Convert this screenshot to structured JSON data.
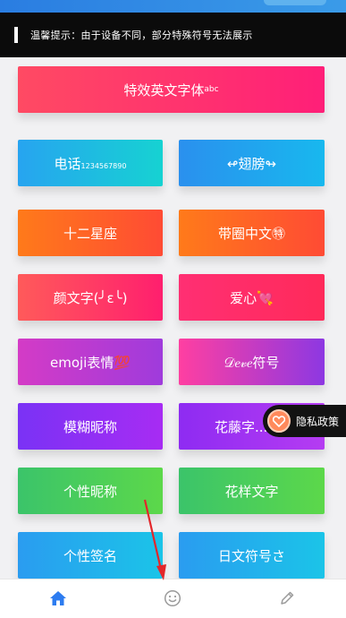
{
  "notice": {
    "text": "温馨提示：由于设备不同，部分特殊符号无法展示"
  },
  "buttons": {
    "special_en": {
      "label": "特效英文字体",
      "sup": "abc"
    },
    "phone": {
      "label": "电话",
      "sub": "1234567890"
    },
    "wings": {
      "label": "↫翅膀↬"
    },
    "zodiac": {
      "label": "十二星座"
    },
    "circled": {
      "label": "带圈中文㊕"
    },
    "kaomoji": {
      "label": "颜文字(╯ε╰)"
    },
    "heart": {
      "label": "爱心💘"
    },
    "emoji": {
      "label": "emoji表情💯"
    },
    "love_symbol": {
      "label": "𝒟𝑒𝓋𝑒符号"
    },
    "blur_nick": {
      "label": "模糊昵称"
    },
    "vine_text": {
      "label": "花藤字..."
    },
    "personal_nick": {
      "label": "个性昵称"
    },
    "fancy_text": {
      "label": "花样文字"
    },
    "signature": {
      "label": "个性签名"
    },
    "jp_symbol": {
      "label": "日文符号さ"
    }
  },
  "privacy": {
    "label": "隐私政策"
  },
  "tabbar": {
    "items": [
      {
        "icon": "home-icon",
        "active": true
      },
      {
        "icon": "smiley-icon",
        "active": false
      },
      {
        "icon": "pen-icon",
        "active": false
      }
    ],
    "active_color": "#2d7cf0",
    "inactive_color": "#9a9a9a"
  }
}
